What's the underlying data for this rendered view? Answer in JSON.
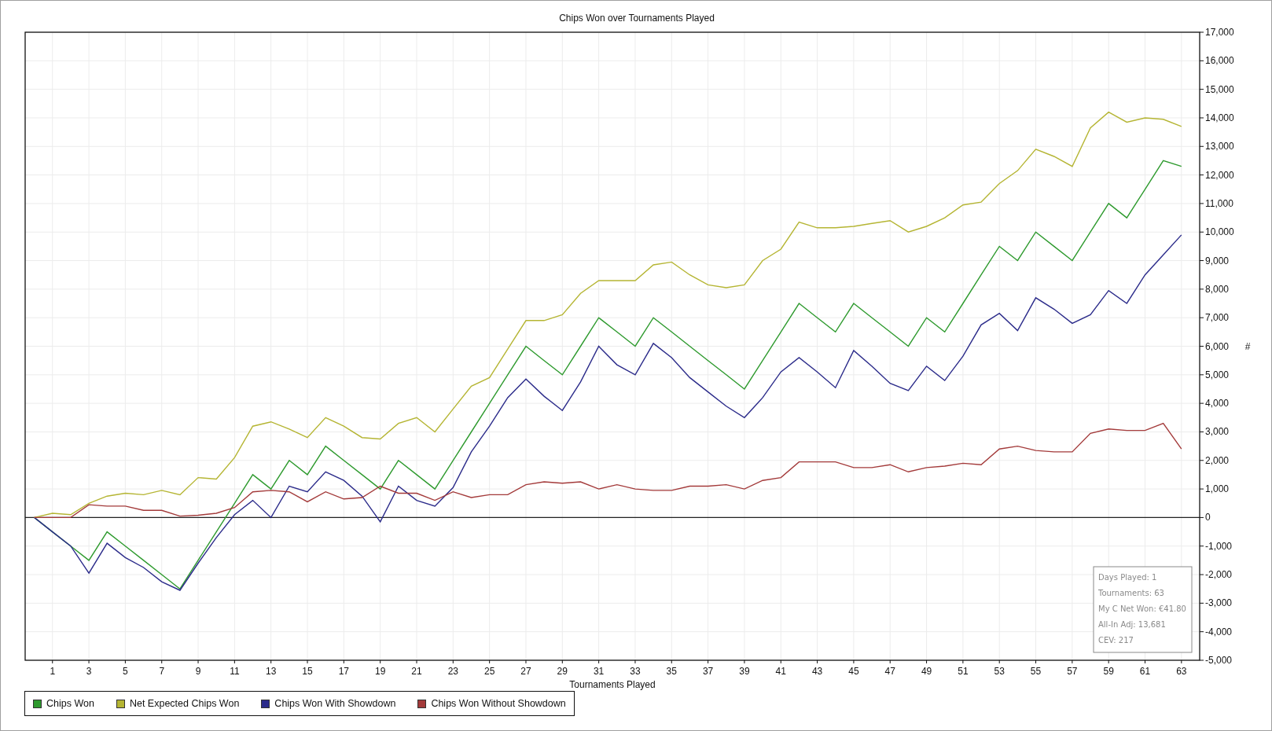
{
  "chart": {
    "chart_data": {
      "type": "line",
      "title": "Chips Won over Tournaments Played",
      "xlabel": "Tournaments Played",
      "ylabel": "#",
      "x": [
        0,
        1,
        2,
        3,
        4,
        5,
        6,
        7,
        8,
        9,
        10,
        11,
        12,
        13,
        14,
        15,
        16,
        17,
        18,
        19,
        20,
        21,
        22,
        23,
        24,
        25,
        26,
        27,
        28,
        29,
        30,
        31,
        32,
        33,
        34,
        35,
        36,
        37,
        38,
        39,
        40,
        41,
        42,
        43,
        44,
        45,
        46,
        47,
        48,
        49,
        50,
        51,
        52,
        53,
        54,
        55,
        56,
        57,
        58,
        59,
        60,
        61,
        62,
        63
      ],
      "series": [
        {
          "name": "Chips Won",
          "color": "#2e9a2e",
          "values": [
            0,
            -500,
            -1000,
            -1500,
            -500,
            -1000,
            -1500,
            -2000,
            -2500,
            -1500,
            -500,
            500,
            1500,
            1000,
            2000,
            1500,
            2500,
            2000,
            1500,
            1000,
            2000,
            1500,
            1000,
            2000,
            3000,
            4000,
            5000,
            6000,
            5500,
            5000,
            6000,
            7000,
            6500,
            6000,
            7000,
            6500,
            6000,
            5500,
            5000,
            4500,
            5500,
            6500,
            7500,
            7000,
            6500,
            7500,
            7000,
            6500,
            6000,
            7000,
            6500,
            7500,
            8500,
            9500,
            9000,
            10000,
            9500,
            9000,
            10000,
            11000,
            10500,
            11500,
            12500,
            12300
          ]
        },
        {
          "name": "Net Expected Chips Won",
          "color": "#b5b533",
          "values": [
            0,
            150,
            100,
            500,
            750,
            850,
            800,
            950,
            800,
            1400,
            1350,
            2100,
            3200,
            3350,
            3100,
            2800,
            3500,
            3200,
            2800,
            2750,
            3300,
            3500,
            3000,
            3800,
            4600,
            4900,
            5900,
            6900,
            6900,
            7100,
            7850,
            8300,
            8300,
            8300,
            8850,
            8950,
            8500,
            8150,
            8050,
            8150,
            9000,
            9400,
            10350,
            10150,
            10150,
            10200,
            10300,
            10400,
            10000,
            10200,
            10500,
            10950,
            11050,
            11700,
            12150,
            12900,
            12650,
            12300,
            13650,
            14200,
            13850,
            14000,
            13950,
            13700
          ]
        },
        {
          "name": "Chips Won With Showdown",
          "color": "#2b2b8a",
          "values": [
            0,
            -500,
            -1000,
            -1950,
            -900,
            -1400,
            -1750,
            -2250,
            -2550,
            -1600,
            -700,
            100,
            600,
            0,
            1100,
            900,
            1600,
            1300,
            750,
            -150,
            1100,
            600,
            400,
            1050,
            2300,
            3200,
            4200,
            4850,
            4250,
            3750,
            4750,
            6000,
            5350,
            5000,
            6100,
            5600,
            4900,
            4400,
            3900,
            3500,
            4200,
            5100,
            5600,
            5100,
            4550,
            5850,
            5300,
            4700,
            4450,
            5300,
            4800,
            5650,
            6750,
            7150,
            6550,
            7700,
            7300,
            6800,
            7100,
            7950,
            7500,
            8500,
            9200,
            9900
          ]
        },
        {
          "name": "Chips Won Without Showdown",
          "color": "#a33a3a",
          "values": [
            0,
            0,
            0,
            450,
            400,
            400,
            250,
            250,
            50,
            80,
            150,
            350,
            900,
            950,
            900,
            550,
            900,
            650,
            700,
            1100,
            850,
            850,
            600,
            900,
            700,
            800,
            800,
            1150,
            1250,
            1200,
            1250,
            1000,
            1150,
            1000,
            950,
            950,
            1100,
            1100,
            1150,
            1000,
            1300,
            1400,
            1950,
            1950,
            1950,
            1750,
            1750,
            1850,
            1600,
            1750,
            1800,
            1900,
            1850,
            2400,
            2500,
            2350,
            2300,
            2300,
            2950,
            3100,
            3050,
            3050,
            3300,
            2400
          ]
        }
      ],
      "xlim": [
        -0.5,
        64
      ],
      "grid": true,
      "ylim": [
        -5000,
        17000
      ],
      "xticks": [
        1,
        3,
        5,
        7,
        9,
        11,
        13,
        15,
        17,
        19,
        21,
        23,
        25,
        27,
        29,
        31,
        33,
        35,
        37,
        39,
        41,
        43,
        45,
        47,
        49,
        51,
        53,
        55,
        57,
        59,
        61,
        63
      ],
      "yticks": [
        {
          "value": -5000,
          "label": "-5,000"
        },
        {
          "value": -4000,
          "label": "-4,000"
        },
        {
          "value": -3000,
          "label": "-3,000"
        },
        {
          "value": -2000,
          "label": "-2,000"
        },
        {
          "value": -1000,
          "label": "-1,000"
        },
        {
          "value": 0,
          "label": "0"
        },
        {
          "value": 1000,
          "label": "1,000"
        },
        {
          "value": 2000,
          "label": "2,000"
        },
        {
          "value": 3000,
          "label": "3,000"
        },
        {
          "value": 4000,
          "label": "4,000"
        },
        {
          "value": 5000,
          "label": "5,000"
        },
        {
          "value": 6000,
          "label": "6,000"
        },
        {
          "value": 7000,
          "label": "7,000"
        },
        {
          "value": 8000,
          "label": "8,000"
        },
        {
          "value": 9000,
          "label": "9,000"
        },
        {
          "value": 10000,
          "label": "10,000"
        },
        {
          "value": 11000,
          "label": "11,000"
        },
        {
          "value": 12000,
          "label": "12,000"
        },
        {
          "value": 13000,
          "label": "13,000"
        },
        {
          "value": 14000,
          "label": "14,000"
        },
        {
          "value": 15000,
          "label": "15,000"
        },
        {
          "value": 16000,
          "label": "16,000"
        },
        {
          "value": 17000,
          "label": "17,000"
        }
      ]
    }
  },
  "stats_box": {
    "lines": [
      "Days Played: 1",
      "Tournaments: 63",
      "My C Net Won: €41.80",
      "All-In Adj: 13,681",
      "CEV: 217"
    ]
  }
}
